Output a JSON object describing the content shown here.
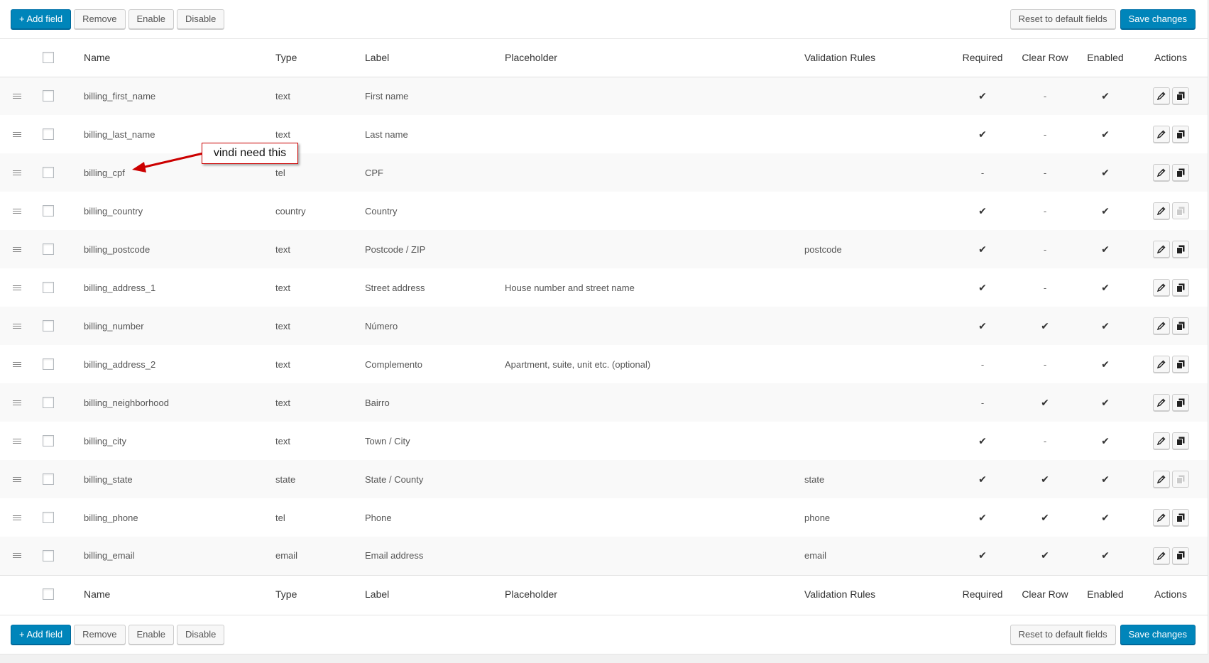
{
  "toolbar": {
    "add_label": "+ Add field",
    "remove_label": "Remove",
    "enable_label": "Enable",
    "disable_label": "Disable",
    "reset_label": "Reset to default fields",
    "save_label": "Save changes"
  },
  "columns": {
    "name": "Name",
    "type": "Type",
    "label": "Label",
    "placeholder": "Placeholder",
    "validation": "Validation Rules",
    "required": "Required",
    "clear_row": "Clear Row",
    "enabled": "Enabled",
    "actions": "Actions"
  },
  "rows": [
    {
      "name": "billing_first_name",
      "type": "text",
      "label": "First name",
      "placeholder": "",
      "validation": "",
      "required": "✔",
      "clear_row": "-",
      "enabled": "✔",
      "copy_enabled": true
    },
    {
      "name": "billing_last_name",
      "type": "text",
      "label": "Last name",
      "placeholder": "",
      "validation": "",
      "required": "✔",
      "clear_row": "-",
      "enabled": "✔",
      "copy_enabled": true
    },
    {
      "name": "billing_cpf",
      "type": "tel",
      "label": "CPF",
      "placeholder": "",
      "validation": "",
      "required": "-",
      "clear_row": "-",
      "enabled": "✔",
      "copy_enabled": true
    },
    {
      "name": "billing_country",
      "type": "country",
      "label": "Country",
      "placeholder": "",
      "validation": "",
      "required": "✔",
      "clear_row": "-",
      "enabled": "✔",
      "copy_enabled": false
    },
    {
      "name": "billing_postcode",
      "type": "text",
      "label": "Postcode / ZIP",
      "placeholder": "",
      "validation": "postcode",
      "required": "✔",
      "clear_row": "-",
      "enabled": "✔",
      "copy_enabled": true
    },
    {
      "name": "billing_address_1",
      "type": "text",
      "label": "Street address",
      "placeholder": "House number and street name",
      "validation": "",
      "required": "✔",
      "clear_row": "-",
      "enabled": "✔",
      "copy_enabled": true
    },
    {
      "name": "billing_number",
      "type": "text",
      "label": "Número",
      "placeholder": "",
      "validation": "",
      "required": "✔",
      "clear_row": "✔",
      "enabled": "✔",
      "copy_enabled": true
    },
    {
      "name": "billing_address_2",
      "type": "text",
      "label": "Complemento",
      "placeholder": "Apartment, suite, unit etc. (optional)",
      "validation": "",
      "required": "-",
      "clear_row": "-",
      "enabled": "✔",
      "copy_enabled": true
    },
    {
      "name": "billing_neighborhood",
      "type": "text",
      "label": "Bairro",
      "placeholder": "",
      "validation": "",
      "required": "-",
      "clear_row": "✔",
      "enabled": "✔",
      "copy_enabled": true
    },
    {
      "name": "billing_city",
      "type": "text",
      "label": "Town / City",
      "placeholder": "",
      "validation": "",
      "required": "✔",
      "clear_row": "-",
      "enabled": "✔",
      "copy_enabled": true
    },
    {
      "name": "billing_state",
      "type": "state",
      "label": "State / County",
      "placeholder": "",
      "validation": "state",
      "required": "✔",
      "clear_row": "✔",
      "enabled": "✔",
      "copy_enabled": false
    },
    {
      "name": "billing_phone",
      "type": "tel",
      "label": "Phone",
      "placeholder": "",
      "validation": "phone",
      "required": "✔",
      "clear_row": "✔",
      "enabled": "✔",
      "copy_enabled": true
    },
    {
      "name": "billing_email",
      "type": "email",
      "label": "Email address",
      "placeholder": "",
      "validation": "email",
      "required": "✔",
      "clear_row": "✔",
      "enabled": "✔",
      "copy_enabled": true
    }
  ],
  "icons": {
    "drag": "drag-handle-icon",
    "edit": "pencil-icon",
    "copy": "copy-icon"
  },
  "annotation": {
    "text": "vindi need this"
  },
  "colors": {
    "primary_button": "#0085ba",
    "annotation_red": "#cc0000"
  }
}
